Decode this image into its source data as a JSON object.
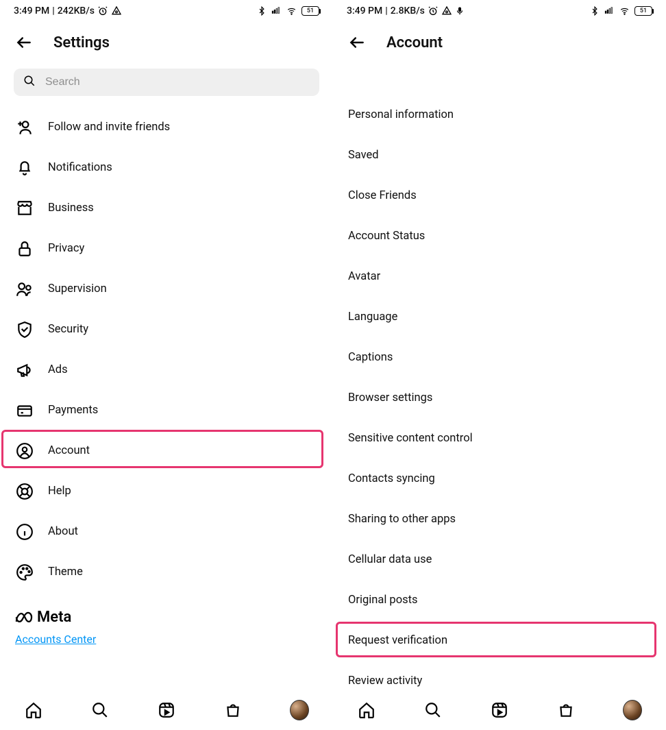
{
  "left": {
    "status": {
      "time": "3:49 PM",
      "net": "242KB/s",
      "battery": "51"
    },
    "title": "Settings",
    "search_placeholder": "Search",
    "items": [
      {
        "label": "Follow and invite friends",
        "icon": "person-plus-icon"
      },
      {
        "label": "Notifications",
        "icon": "bell-icon"
      },
      {
        "label": "Business",
        "icon": "storefront-icon"
      },
      {
        "label": "Privacy",
        "icon": "lock-icon"
      },
      {
        "label": "Supervision",
        "icon": "people-icon"
      },
      {
        "label": "Security",
        "icon": "shield-check-icon"
      },
      {
        "label": "Ads",
        "icon": "megaphone-icon"
      },
      {
        "label": "Payments",
        "icon": "card-icon"
      },
      {
        "label": "Account",
        "icon": "user-circle-icon",
        "highlight": true
      },
      {
        "label": "Help",
        "icon": "lifebuoy-icon"
      },
      {
        "label": "About",
        "icon": "info-icon"
      },
      {
        "label": "Theme",
        "icon": "palette-icon"
      }
    ],
    "meta_label": "Meta",
    "accounts_center": "Accounts Center"
  },
  "right": {
    "status": {
      "time": "3:49 PM",
      "net": "2.8KB/s",
      "battery": "51"
    },
    "title": "Account",
    "items": [
      {
        "label": "Personal information"
      },
      {
        "label": "Saved"
      },
      {
        "label": "Close Friends"
      },
      {
        "label": "Account Status"
      },
      {
        "label": "Avatar"
      },
      {
        "label": "Language"
      },
      {
        "label": "Captions"
      },
      {
        "label": "Browser settings"
      },
      {
        "label": "Sensitive content control"
      },
      {
        "label": "Contacts syncing"
      },
      {
        "label": "Sharing to other apps"
      },
      {
        "label": "Cellular data use"
      },
      {
        "label": "Original posts"
      },
      {
        "label": "Request verification",
        "highlight": true
      },
      {
        "label": "Review activity"
      }
    ]
  },
  "highlight_color": "#e6356f"
}
